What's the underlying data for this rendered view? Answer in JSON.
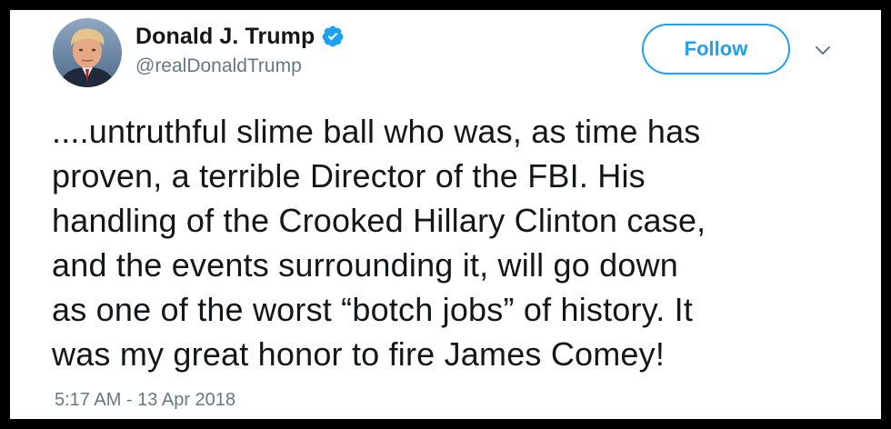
{
  "tweet": {
    "author": {
      "display_name": "Donald J. Trump",
      "handle": "@realDonaldTrump",
      "verified": true,
      "avatar_icon": "profile-photo"
    },
    "follow_label": "Follow",
    "menu_icon": "chevron-down-icon",
    "text_lines": [
      "....untruthful slime ball who was, as time has",
      "proven, a terrible Director of the FBI. His",
      "handling of the Crooked Hillary Clinton case,",
      "and the events surrounding it, will go down",
      "as one of the worst “botch jobs” of history. It",
      "was my great honor to fire James Comey!"
    ],
    "timestamp": "5:17 AM - 13 Apr 2018"
  },
  "colors": {
    "accent": "#1da1f2",
    "text_primary": "#14171a",
    "text_secondary": "#657786",
    "frame_border": "#000000",
    "background": "#ffffff"
  }
}
